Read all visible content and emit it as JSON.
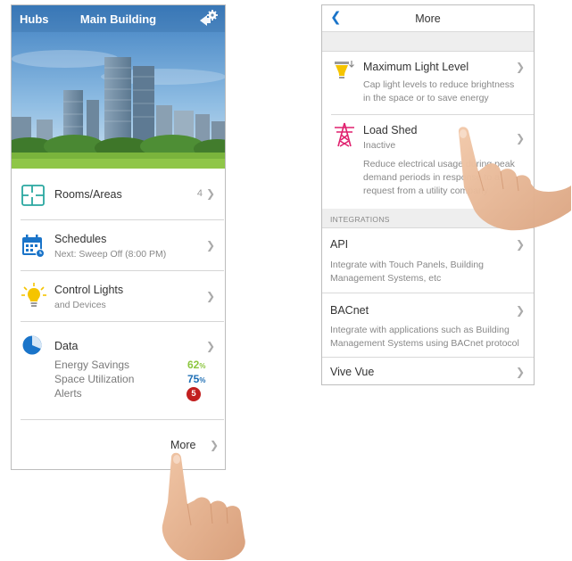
{
  "left_screen": {
    "header": {
      "hubs_label": "Hubs",
      "title": "Main Building",
      "settings_icon": "gear-icon"
    },
    "rows": [
      {
        "label": "Rooms/Areas",
        "count": "4",
        "icon": "floor-plan-icon"
      },
      {
        "label": "Schedules",
        "sub": "Next: Sweep Off (8:00 PM)",
        "icon": "calendar-icon"
      },
      {
        "label": "Control Lights",
        "sub": "and Devices",
        "icon": "lightbulb-icon"
      },
      {
        "label": "Data",
        "icon": "pie-chart-icon"
      }
    ],
    "data": {
      "energy_label": "Energy Savings",
      "energy_value": "62",
      "space_label": "Space Utilization",
      "space_value": "75",
      "pct_symbol": "%",
      "alerts_label": "Alerts",
      "alerts_count": "5"
    },
    "more_label": "More",
    "colors": {
      "energy": "#8cc63f",
      "space": "#1f6fb5",
      "alert": "#c21f1f",
      "icon_teal": "#2aa7a0",
      "icon_blue": "#1a74c9",
      "icon_yellow": "#f5c400"
    }
  },
  "right_screen": {
    "header": {
      "title": "More",
      "back_icon": "chevron-left-icon"
    },
    "items": [
      {
        "title": "Maximum Light Level",
        "desc": "Cap light levels to reduce brightness in the space or to save energy",
        "icon": "light-limit-icon"
      },
      {
        "title": "Load Shed",
        "sub": "Inactive",
        "desc": "Reduce electrical usage during peak demand periods in response to a request from a utility company",
        "icon": "power-tower-icon"
      }
    ],
    "integrations_header": "INTEGRATIONS",
    "integrations": [
      {
        "title": "API",
        "desc": "Integrate with Touch Panels, Building Management Systems, etc"
      },
      {
        "title": "BACnet",
        "desc": "Integrate with applications such as Building Management Systems using BACnet protocol"
      },
      {
        "title": "Vive Vue"
      }
    ],
    "colors": {
      "load_shed": "#e0206e",
      "max_light": "#f5c400"
    }
  }
}
